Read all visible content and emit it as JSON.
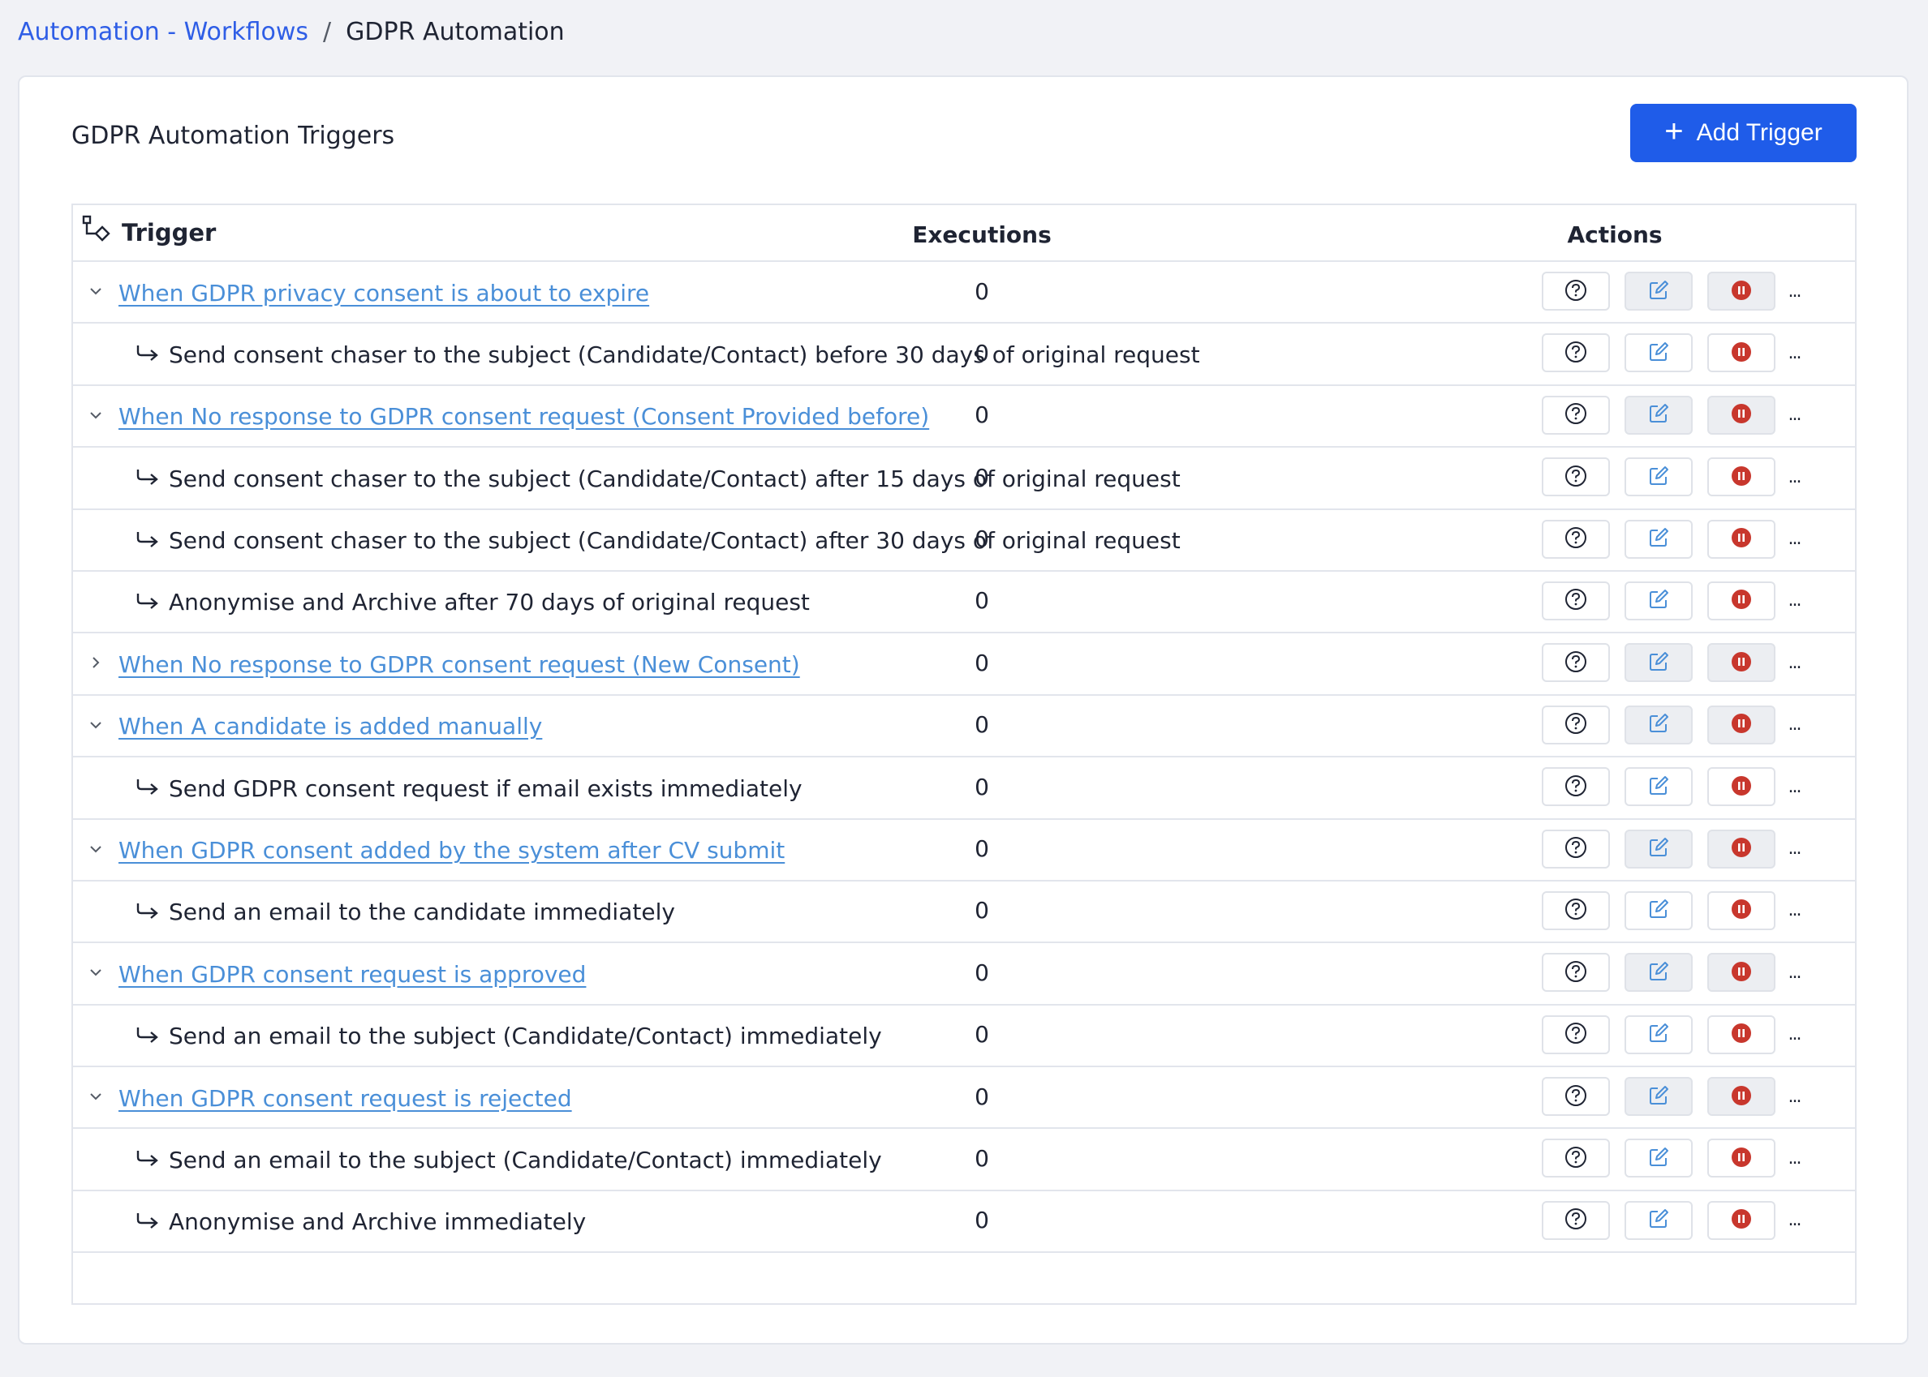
{
  "breadcrumb": {
    "parent": "Automation - Workflows",
    "separator": "/",
    "current": "GDPR Automation"
  },
  "card": {
    "title": "GDPR Automation Triggers",
    "add_button": {
      "label": "Add Trigger",
      "icon": "plus-icon"
    }
  },
  "table": {
    "headers": {
      "trigger": "Trigger",
      "executions": "Executions",
      "actions": "Actions"
    },
    "more_label": "...",
    "rows": [
      {
        "type": "trigger",
        "expanded": true,
        "label": "When GDPR privacy consent is about to expire",
        "executions": "0"
      },
      {
        "type": "action",
        "label": "Send consent chaser to the subject (Candidate/Contact) before 30 days of original request",
        "executions": "0"
      },
      {
        "type": "trigger",
        "expanded": true,
        "label": "When No response to GDPR consent request (Consent Provided before)",
        "executions": "0"
      },
      {
        "type": "action",
        "label": "Send consent chaser to the subject (Candidate/Contact) after 15 days of original request",
        "executions": "0"
      },
      {
        "type": "action",
        "label": "Send consent chaser to the subject (Candidate/Contact) after 30 days of original request",
        "executions": "0"
      },
      {
        "type": "action",
        "label": "Anonymise and Archive after 70 days of original request",
        "executions": "0"
      },
      {
        "type": "trigger",
        "expanded": false,
        "label": "When No response to GDPR consent request (New Consent)",
        "executions": "0"
      },
      {
        "type": "trigger",
        "expanded": true,
        "label": "When A candidate is added manually",
        "executions": "0"
      },
      {
        "type": "action",
        "label": "Send GDPR consent request if email exists immediately",
        "executions": "0"
      },
      {
        "type": "trigger",
        "expanded": true,
        "label": "When GDPR consent added by the system after CV submit",
        "executions": "0"
      },
      {
        "type": "action",
        "label": "Send an email to the candidate immediately",
        "executions": "0"
      },
      {
        "type": "trigger",
        "expanded": true,
        "label": "When GDPR consent request is approved",
        "executions": "0"
      },
      {
        "type": "action",
        "label": "Send an email to the subject (Candidate/Contact) immediately",
        "executions": "0"
      },
      {
        "type": "trigger",
        "expanded": true,
        "label": "When GDPR consent request is rejected",
        "executions": "0"
      },
      {
        "type": "action",
        "label": "Send an email to the subject (Candidate/Contact) immediately",
        "executions": "0"
      },
      {
        "type": "action",
        "label": "Anonymise and Archive immediately",
        "executions": "0"
      }
    ]
  },
  "icons": {
    "trigger_header": "workflow-icon",
    "expand": "chevron-down-icon",
    "collapsed": "chevron-right-icon",
    "sub_action": "arrow-return-icon",
    "help": "help-circle-icon",
    "edit": "edit-icon",
    "pause": "pause-circle-icon"
  },
  "colors": {
    "accent": "#1f5ce9",
    "link": "#4a8fd8",
    "pause": "#c8372d",
    "border": "#e2e5ec",
    "background": "#f1f2f6"
  }
}
